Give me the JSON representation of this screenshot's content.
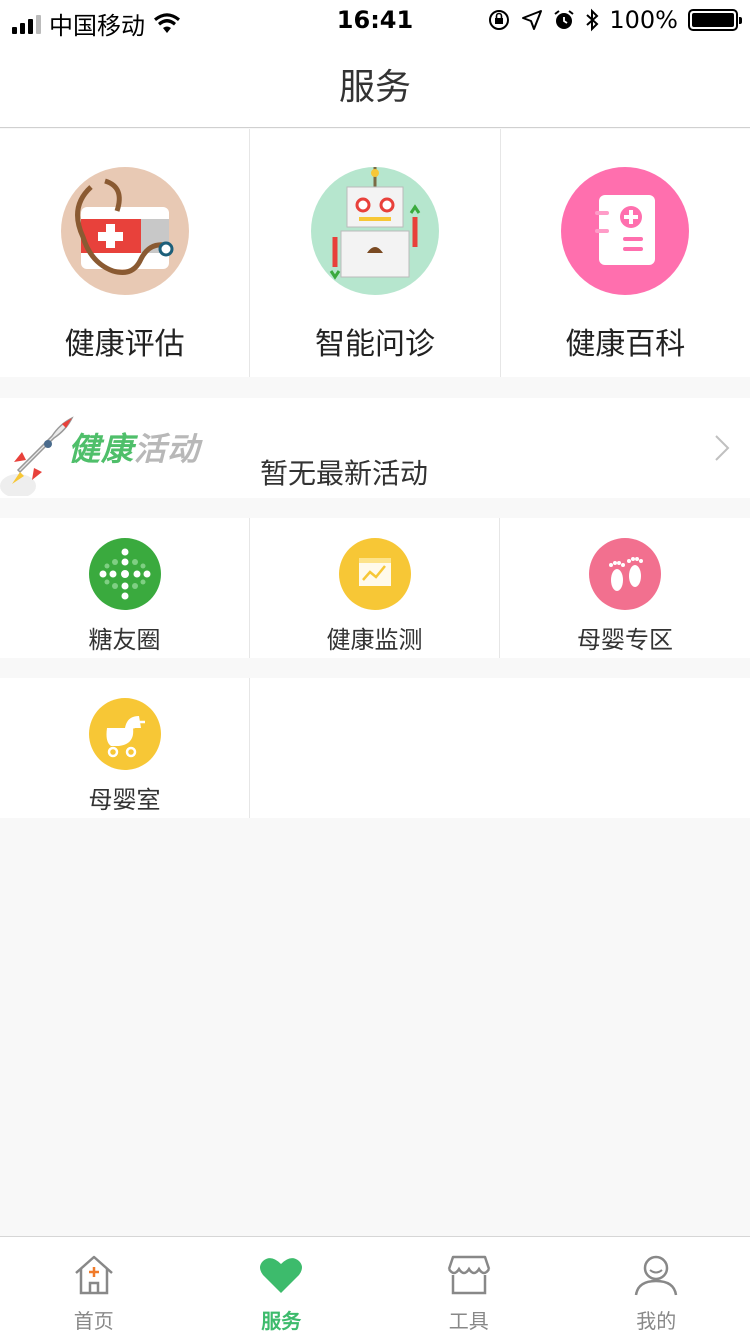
{
  "status_bar": {
    "carrier": "中国移动",
    "time": "16:41",
    "battery": "100%",
    "icons": [
      "signal-icon",
      "wifi-icon",
      "orientation-lock-icon",
      "location-icon",
      "alarm-icon",
      "bluetooth-icon",
      "battery-icon"
    ]
  },
  "header": {
    "title": "服务"
  },
  "services": [
    {
      "label": "健康评估",
      "icon": "first-aid-kit-icon",
      "color": "#e8c9b4"
    },
    {
      "label": "智能问诊",
      "icon": "robot-icon",
      "color": "#b6e6ce"
    },
    {
      "label": "健康百科",
      "icon": "medical-book-icon",
      "color": "#ff6fae"
    }
  ],
  "activity": {
    "logo_text_green": "健康",
    "logo_text_gray": "活动",
    "message": "暂无最新活动",
    "icon": "rocket-icon"
  },
  "small_services": [
    {
      "label": "糖友圈",
      "icon": "dots-cross-icon",
      "color": "#3aaa3e"
    },
    {
      "label": "健康监测",
      "icon": "monitor-chart-icon",
      "color": "#f7c736"
    },
    {
      "label": "母婴专区",
      "icon": "baby-footprint-icon",
      "color": "#f2708f"
    },
    {
      "label": "母婴室",
      "icon": "baby-stroller-icon",
      "color": "#f7c736"
    }
  ],
  "tabs": [
    {
      "label": "首页",
      "icon": "home-icon",
      "active": false
    },
    {
      "label": "服务",
      "icon": "heart-icon",
      "active": true
    },
    {
      "label": "工具",
      "icon": "store-icon",
      "active": false
    },
    {
      "label": "我的",
      "icon": "user-icon",
      "active": false
    }
  ],
  "colors": {
    "accent": "#3dbb6c",
    "background": "#f8f8f8"
  }
}
